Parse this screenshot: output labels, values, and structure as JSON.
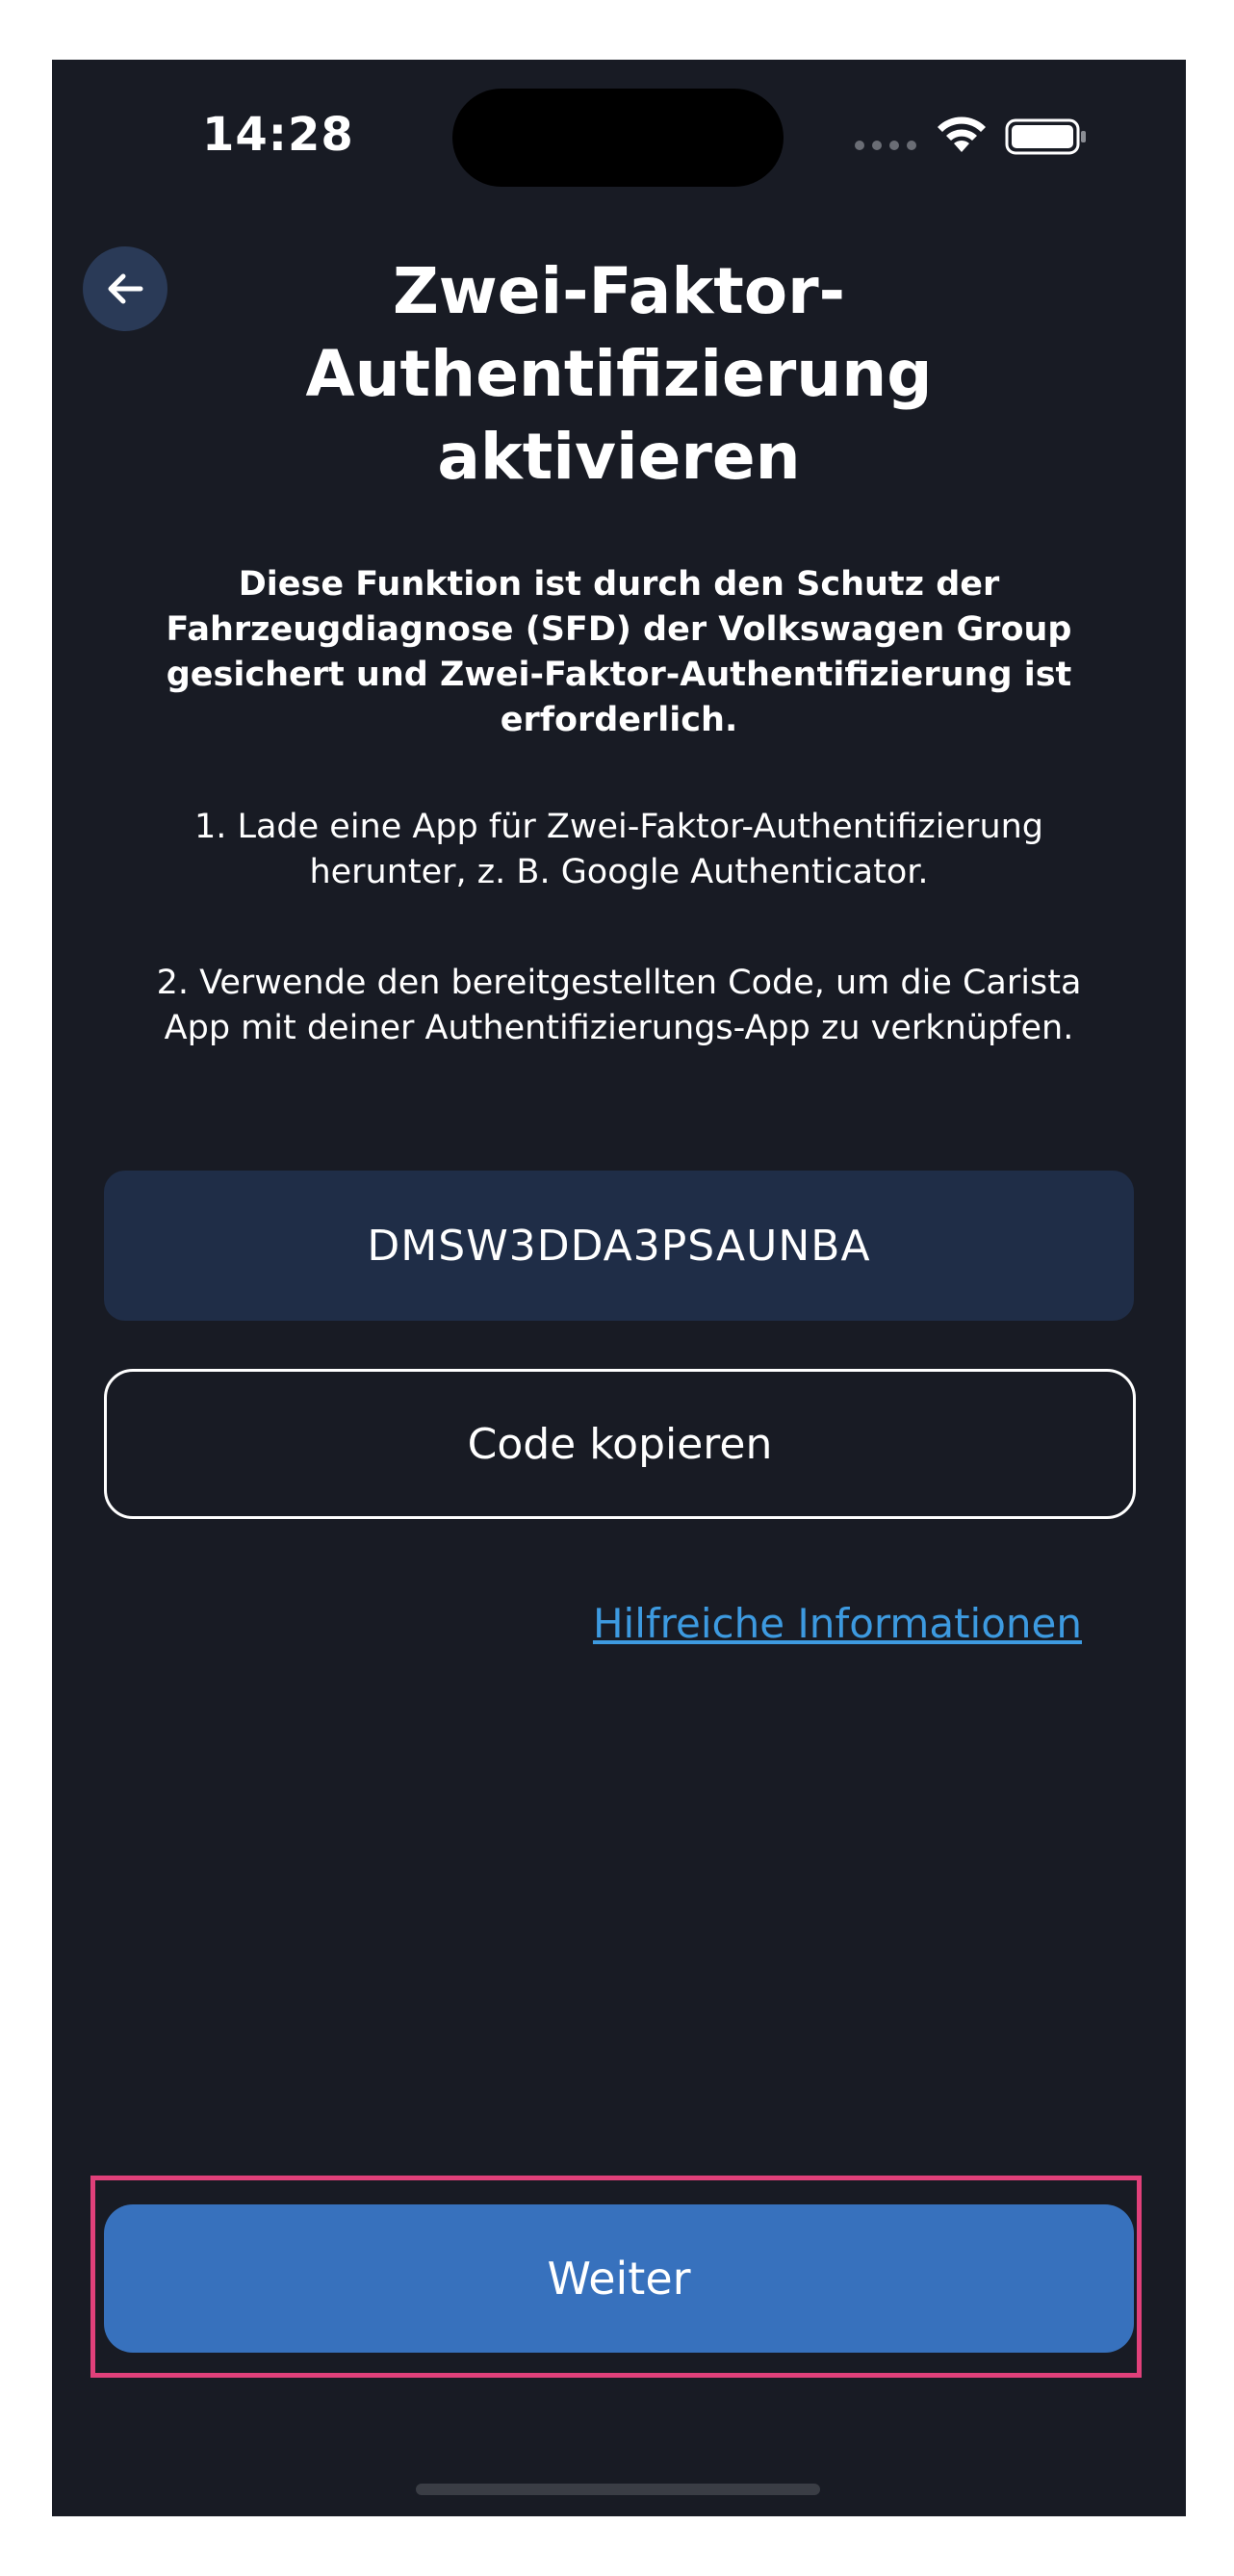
{
  "status_bar": {
    "time": "14:28"
  },
  "header": {
    "back_icon": "arrow-left-icon",
    "title_line1": "Zwei-Faktor-",
    "title_line2": "Authentifizierung",
    "title_line3": "aktivieren"
  },
  "intro": {
    "line1": "Diese Funktion ist durch den Schutz der",
    "line2": "Fahrzeugdiagnose (SFD) der Volkswagen Group",
    "line3": "gesichert und Zwei-Faktor-Authentifizierung ist",
    "line4": "erforderlich."
  },
  "steps": [
    {
      "line1": "1. Lade eine App für Zwei-Faktor-Authentifizierung",
      "line2": "herunter, z. B. Google Authenticator."
    },
    {
      "line1": "2. Verwende den bereitgestellten Code, um die Carista",
      "line2": "App mit deiner Authentifizierungs-App zu verknüpfen."
    }
  ],
  "code": {
    "value": "DMSW3DDA3PSAUNBA",
    "copy_label": "Code kopieren"
  },
  "help_link": "Hilfreiche Informationen",
  "continue_label": "Weiter",
  "colors": {
    "background": "#181b24",
    "code_box": "#1f2d47",
    "accent": "#3771bd",
    "link": "#3d9ae0",
    "highlight": "#e0407a"
  }
}
